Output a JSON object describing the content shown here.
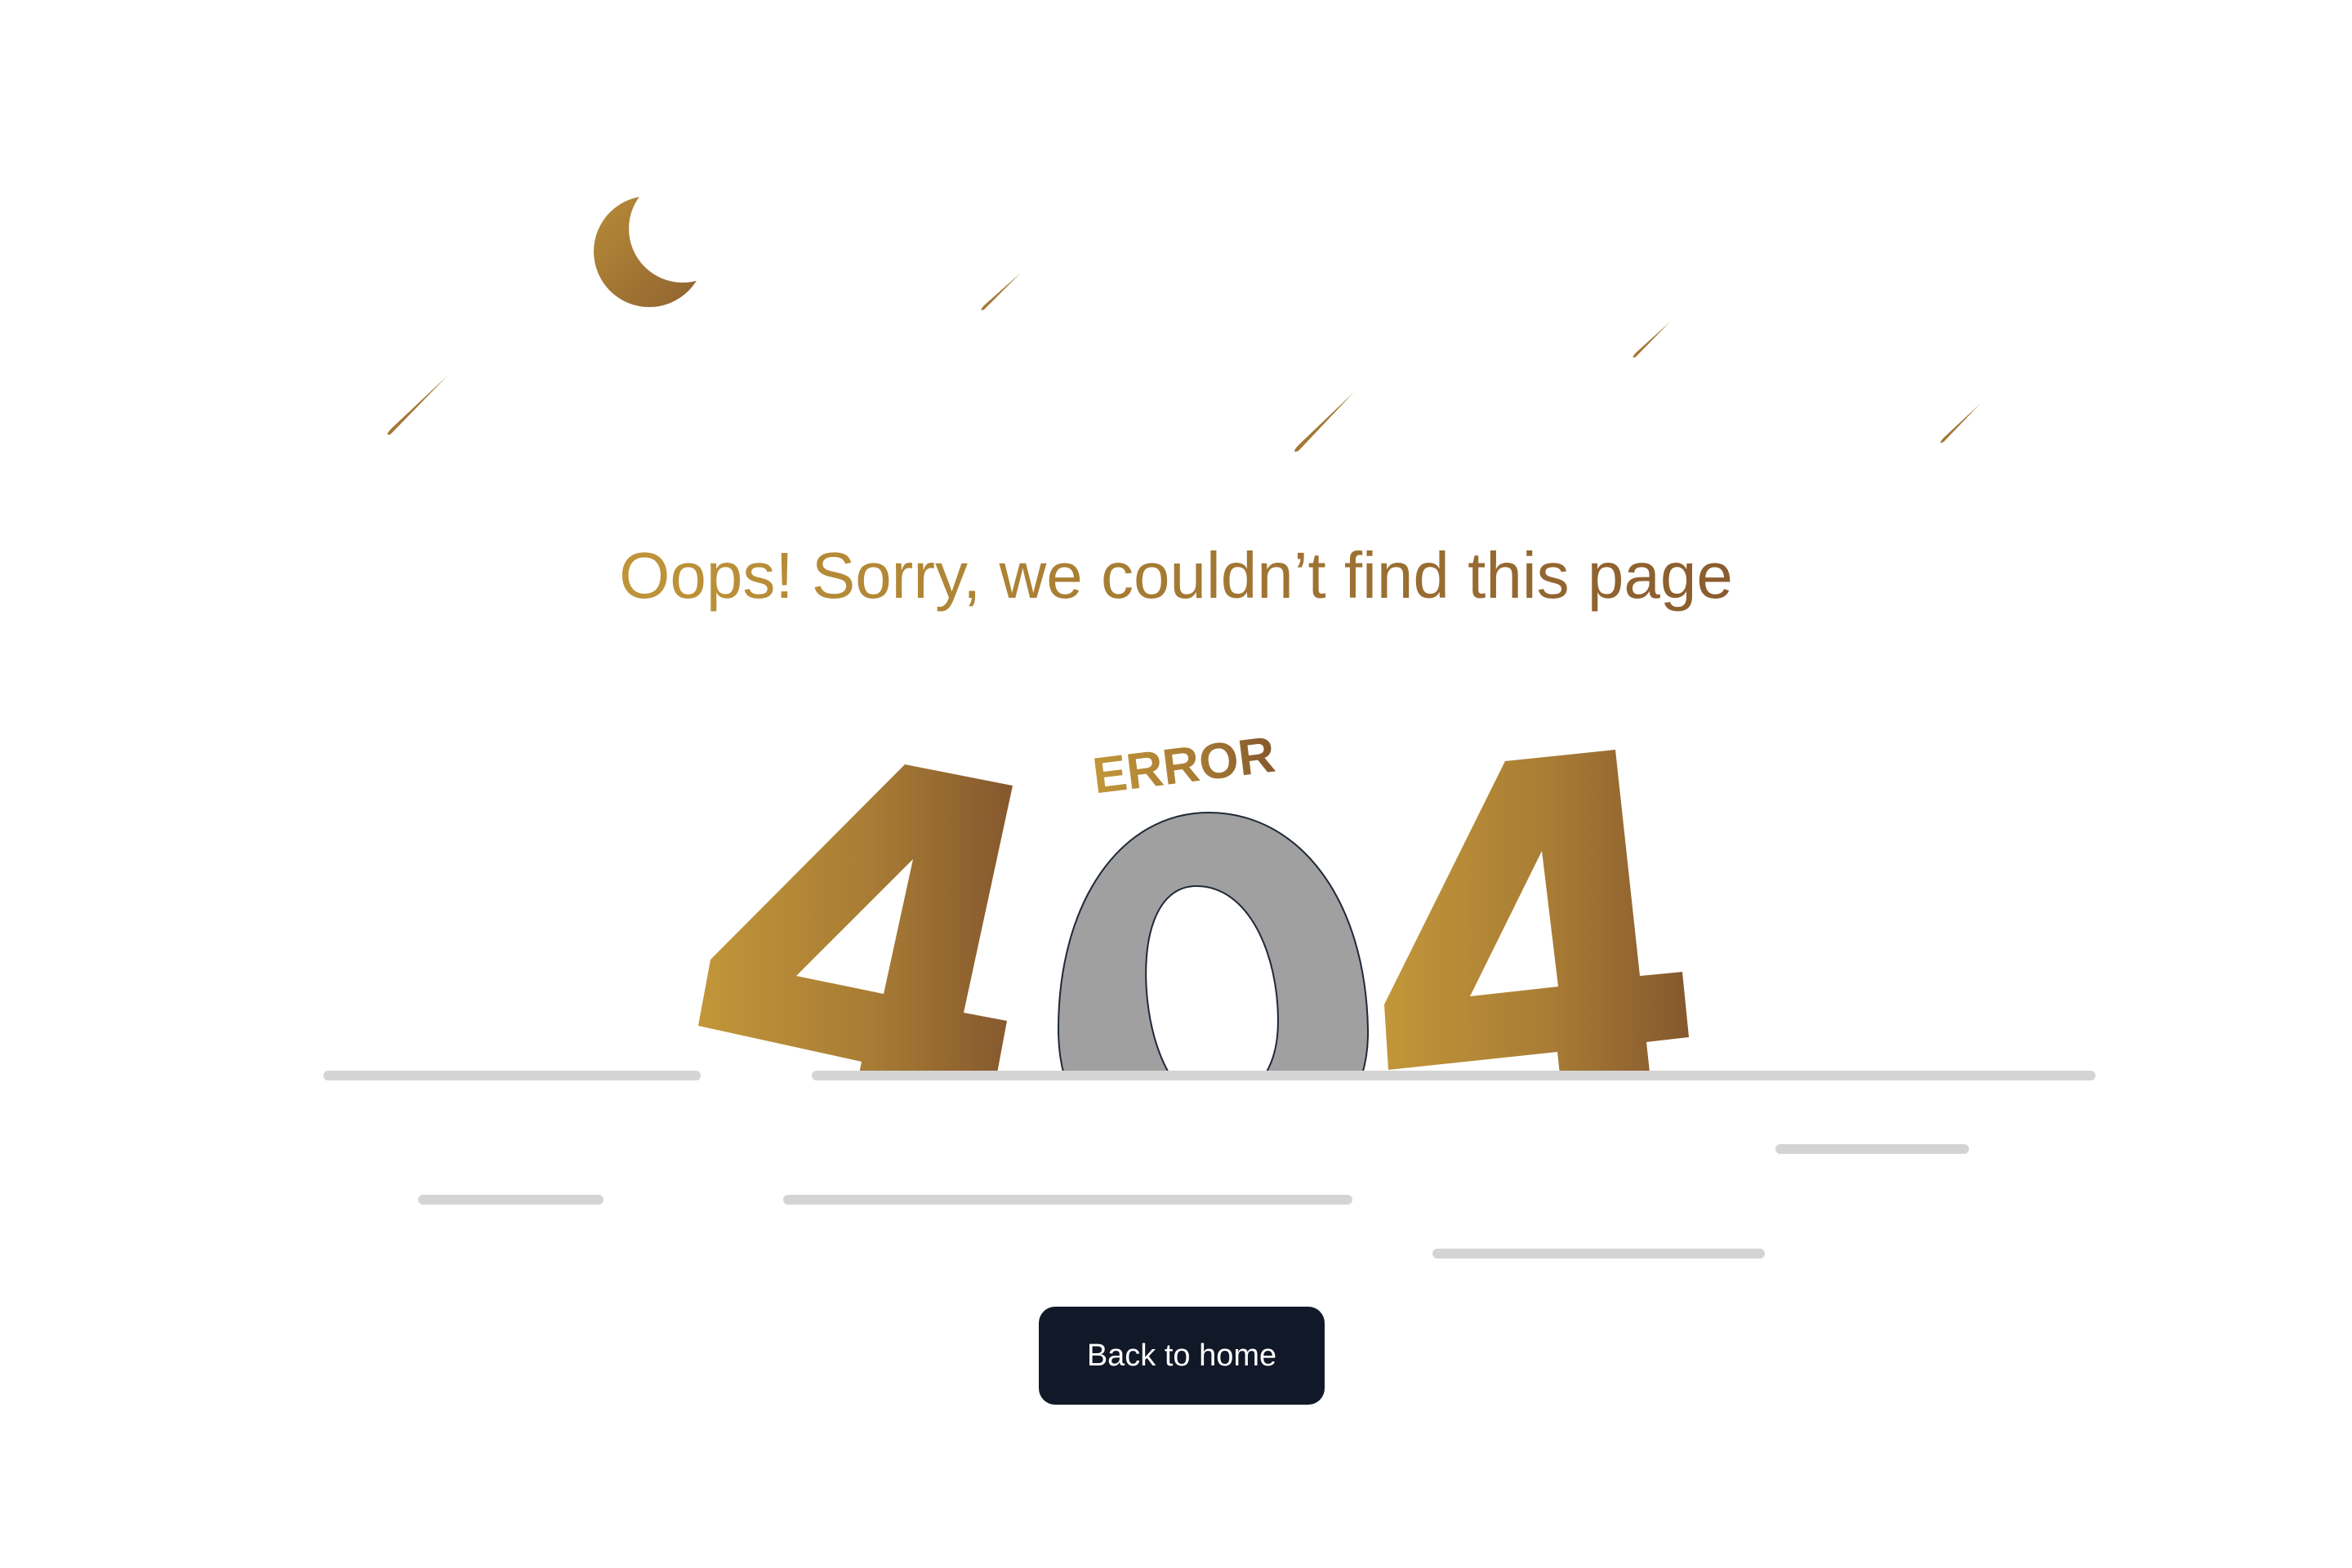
{
  "headline": "Oops! Sorry, we couldn’t find this page",
  "illustration": {
    "badge_text": "ERROR",
    "left_digit": "4",
    "middle_digit": "0",
    "right_digit": "4"
  },
  "actions": {
    "back_home_label": "Back to home"
  },
  "colors": {
    "gold_start": "#bf9439",
    "gold_end": "#85582e",
    "zero_fill": "#a0a0a0",
    "ground_lines": "#d4d4d4",
    "button_bg": "#111827",
    "button_text": "#ffffff"
  },
  "icons": [
    "moon-icon",
    "shooting-star-icon"
  ]
}
